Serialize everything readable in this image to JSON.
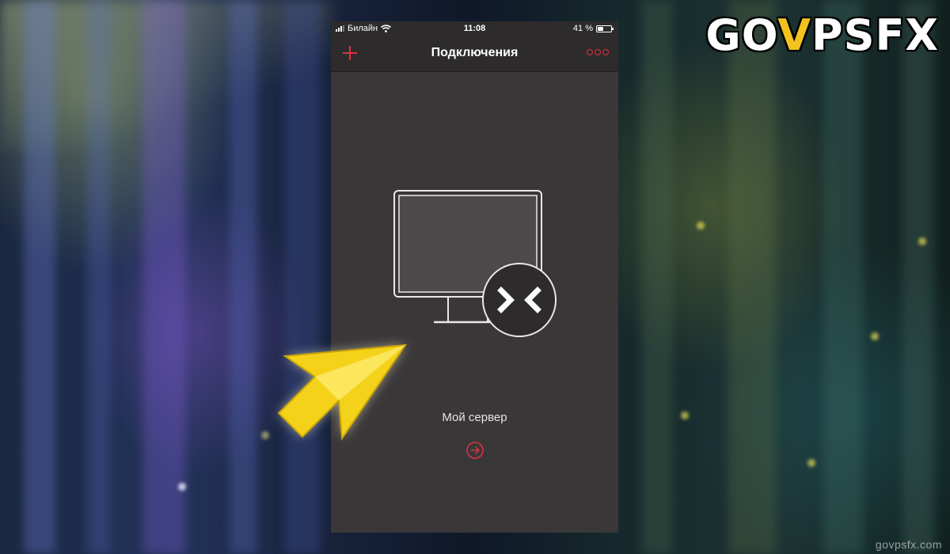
{
  "status_bar": {
    "carrier": "Билайн",
    "time": "11:08",
    "battery_text": "41 %",
    "battery_level": 0.41,
    "wifi_icon": "wifi-icon",
    "signal_icon": "cellular-signal-icon"
  },
  "nav": {
    "title": "Подключения",
    "add_icon": "plus-icon",
    "more_icon": "more-dots-icon"
  },
  "connection": {
    "name": "Мой сервер",
    "icon": "remote-desktop-monitor-icon",
    "connect_icon": "arrow-right-circle-icon"
  },
  "branding": {
    "logo_prefix": "GO",
    "logo_accent": "V",
    "logo_suffix": "PSFX",
    "watermark": "govpsfx.com"
  },
  "colors": {
    "accent": "#e0323f",
    "pointer_arrow": "#f5d21a",
    "screen_bg": "#3a3739",
    "bar_bg": "#2d2b2c"
  }
}
